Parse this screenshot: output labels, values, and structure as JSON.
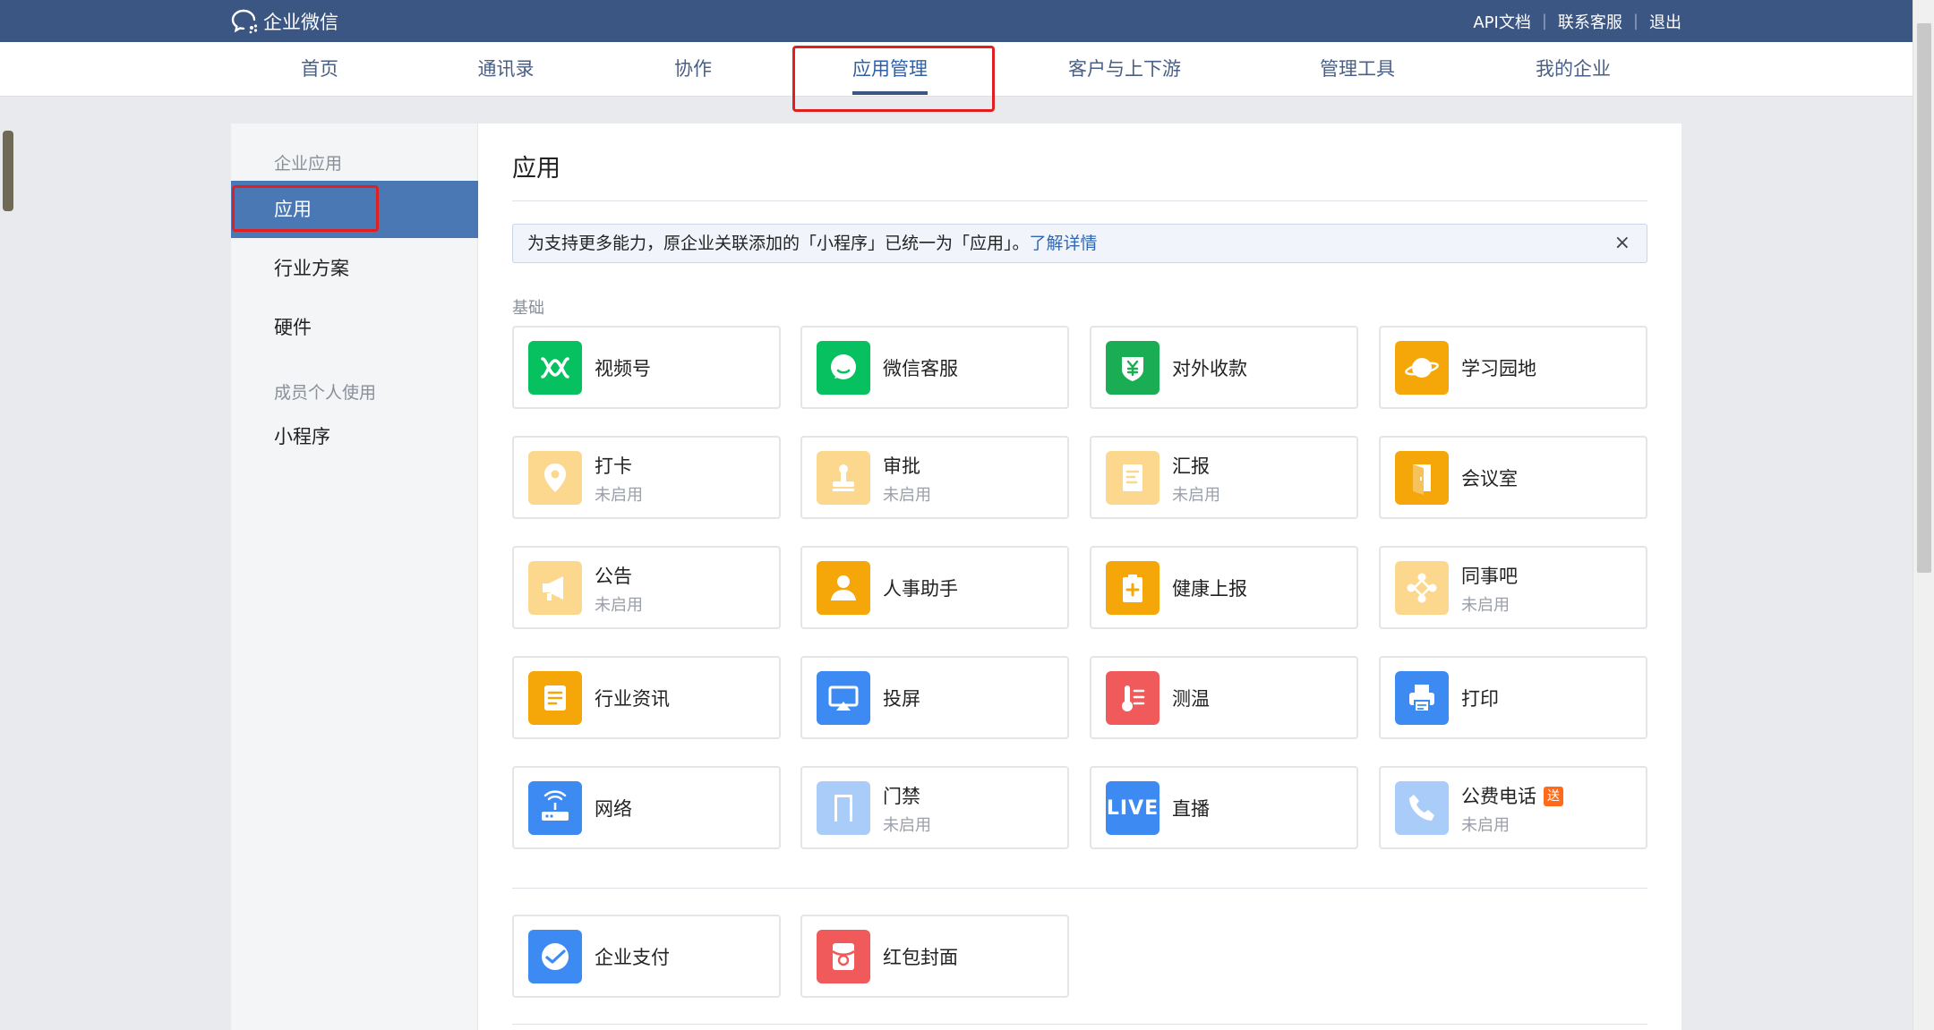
{
  "header": {
    "logo_text": "企业微信",
    "links": [
      "API文档",
      "联系客服",
      "退出"
    ]
  },
  "nav": {
    "items": [
      "首页",
      "通讯录",
      "协作",
      "应用管理",
      "客户与上下游",
      "管理工具",
      "我的企业"
    ],
    "active": "应用管理"
  },
  "sidebar": {
    "group1": "企业应用",
    "items1": [
      "应用",
      "行业方案",
      "硬件"
    ],
    "group2": "成员个人使用",
    "items2": [
      "小程序"
    ],
    "active": "应用"
  },
  "main": {
    "title": "应用",
    "notice_text": "为支持更多能力，原企业关联添加的「小程序」已统一为「应用」。",
    "notice_link": "了解详情",
    "notice_close": "×",
    "section_label": "基础",
    "apps": [
      {
        "name": "视频号",
        "status": "",
        "icon": "channels-icon",
        "color": "#07c160"
      },
      {
        "name": "微信客服",
        "status": "",
        "icon": "wechat-kf-icon",
        "color": "#07c160"
      },
      {
        "name": "对外收款",
        "status": "",
        "icon": "payment-icon",
        "color": "#1aad54"
      },
      {
        "name": "学习园地",
        "status": "",
        "icon": "planet-icon",
        "color": "#f5a70a"
      },
      {
        "name": "打卡",
        "status": "未启用",
        "icon": "location-pin-icon",
        "color": "#fbd88e"
      },
      {
        "name": "审批",
        "status": "未启用",
        "icon": "stamp-icon",
        "color": "#fbd88e"
      },
      {
        "name": "汇报",
        "status": "未启用",
        "icon": "report-icon",
        "color": "#fbd88e"
      },
      {
        "name": "会议室",
        "status": "",
        "icon": "door-icon",
        "color": "#f5a70a"
      },
      {
        "name": "公告",
        "status": "未启用",
        "icon": "megaphone-icon",
        "color": "#fbd88e"
      },
      {
        "name": "人事助手",
        "status": "",
        "icon": "person-icon",
        "color": "#f5a70a"
      },
      {
        "name": "健康上报",
        "status": "",
        "icon": "medical-clipboard-icon",
        "color": "#f5a70a"
      },
      {
        "name": "同事吧",
        "status": "未启用",
        "icon": "community-icon",
        "color": "#fbd88e"
      },
      {
        "name": "行业资讯",
        "status": "",
        "icon": "news-icon",
        "color": "#f5a70a"
      },
      {
        "name": "投屏",
        "status": "",
        "icon": "screen-cast-icon",
        "color": "#3d8bf2"
      },
      {
        "name": "测温",
        "status": "",
        "icon": "thermometer-icon",
        "color": "#f05a5a"
      },
      {
        "name": "打印",
        "status": "",
        "icon": "printer-icon",
        "color": "#3d8bf2"
      },
      {
        "name": "网络",
        "status": "",
        "icon": "router-icon",
        "color": "#3d8bf2"
      },
      {
        "name": "门禁",
        "status": "未启用",
        "icon": "access-door-icon",
        "color": "#a9ccf8"
      },
      {
        "name": "直播",
        "status": "",
        "icon": "live-icon",
        "color": "#3d8bf2",
        "icon_text": "LIVE"
      },
      {
        "name": "公费电话",
        "status": "未启用",
        "icon": "phone-icon",
        "color": "#a9ccf8",
        "badge": "送"
      }
    ],
    "apps2": [
      {
        "name": "企业支付",
        "status": "",
        "icon": "enterprise-pay-icon",
        "color": "#3d8bf2"
      },
      {
        "name": "红包封面",
        "status": "",
        "icon": "red-envelope-icon",
        "color": "#f05a5a"
      }
    ]
  }
}
